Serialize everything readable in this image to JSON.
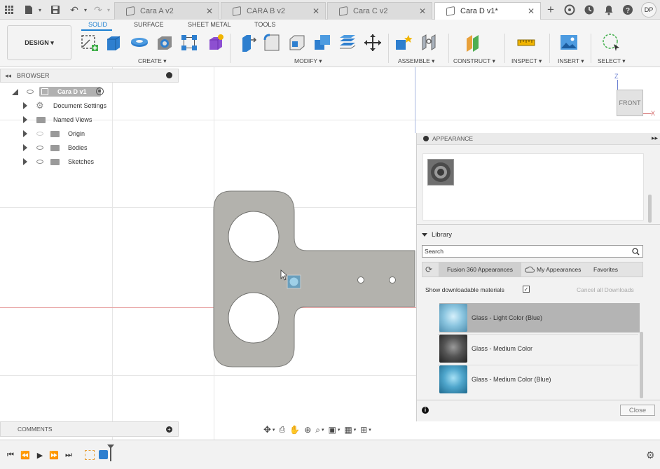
{
  "document_tabs": [
    {
      "label": "Cara A v2",
      "active": false
    },
    {
      "label": "CARA B v2",
      "active": false
    },
    {
      "label": "Cara C v2",
      "active": false
    },
    {
      "label": "Cara D v1*",
      "active": true
    }
  ],
  "user_initials": "DP",
  "workspace": "DESIGN ▾",
  "ribbon_tabs": [
    "SOLID",
    "SURFACE",
    "SHEET METAL",
    "TOOLS"
  ],
  "tool_groups": [
    "CREATE ▾",
    "MODIFY ▾",
    "ASSEMBLE ▾",
    "CONSTRUCT ▾",
    "INSPECT ▾",
    "INSERT ▾",
    "SELECT ▾"
  ],
  "browser": {
    "title": "BROWSER",
    "root": "Cara D v1",
    "items": [
      "Document Settings",
      "Named Views",
      "Origin",
      "Bodies",
      "Sketches"
    ]
  },
  "viewcube": {
    "face": "FRONT",
    "axis_z": "Z",
    "axis_x": "X"
  },
  "appearance": {
    "title": "APPEARANCE",
    "library_label": "Library",
    "search_placeholder": "Search",
    "tabs": [
      "Fusion 360 Appearances",
      "My Appearances",
      "Favorites"
    ],
    "show_downloadable": "Show downloadable materials",
    "cancel_downloads": "Cancel all Downloads",
    "materials": [
      "Glass - Light Color (Blue)",
      "Glass - Medium Color",
      "Glass - Medium Color (Blue)"
    ],
    "close_label": "Close"
  },
  "comments_label": "COMMENTS",
  "colors": {
    "accent": "#1a7fd1",
    "body": "#b3b2ad",
    "selected_row": "#b4b4b4"
  }
}
